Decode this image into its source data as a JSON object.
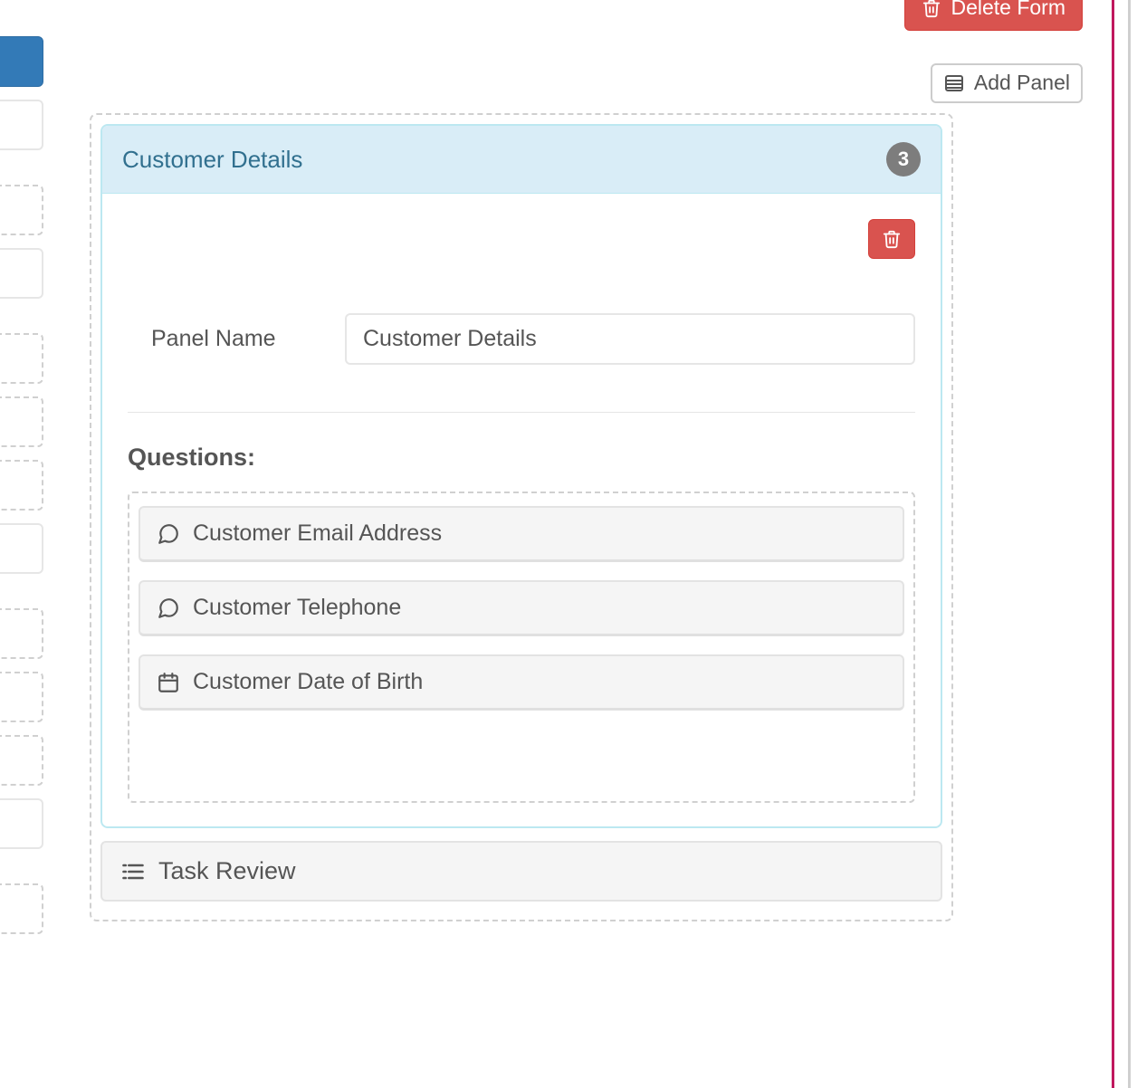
{
  "colors": {
    "danger": "#d9534f",
    "info_bg": "#d9edf7",
    "info_border": "#bce8f1",
    "info_text": "#31708f",
    "primary": "#337ab7",
    "stripe_pink": "#c0185e"
  },
  "actions": {
    "delete_form": "Delete Form",
    "add_panel": "Add Panel"
  },
  "form_builder": {
    "active_panel": {
      "title": "Customer Details",
      "count": 3,
      "fields": {
        "panel_name_label": "Panel Name",
        "panel_name_value": "Customer Details"
      },
      "questions_label": "Questions:",
      "questions": [
        {
          "icon": "comment",
          "label": "Customer Email Address"
        },
        {
          "icon": "comment",
          "label": "Customer Telephone"
        },
        {
          "icon": "calendar",
          "label": "Customer Date of Birth"
        }
      ]
    },
    "collapsed_panel": {
      "icon": "list",
      "label": "Task Review"
    }
  }
}
